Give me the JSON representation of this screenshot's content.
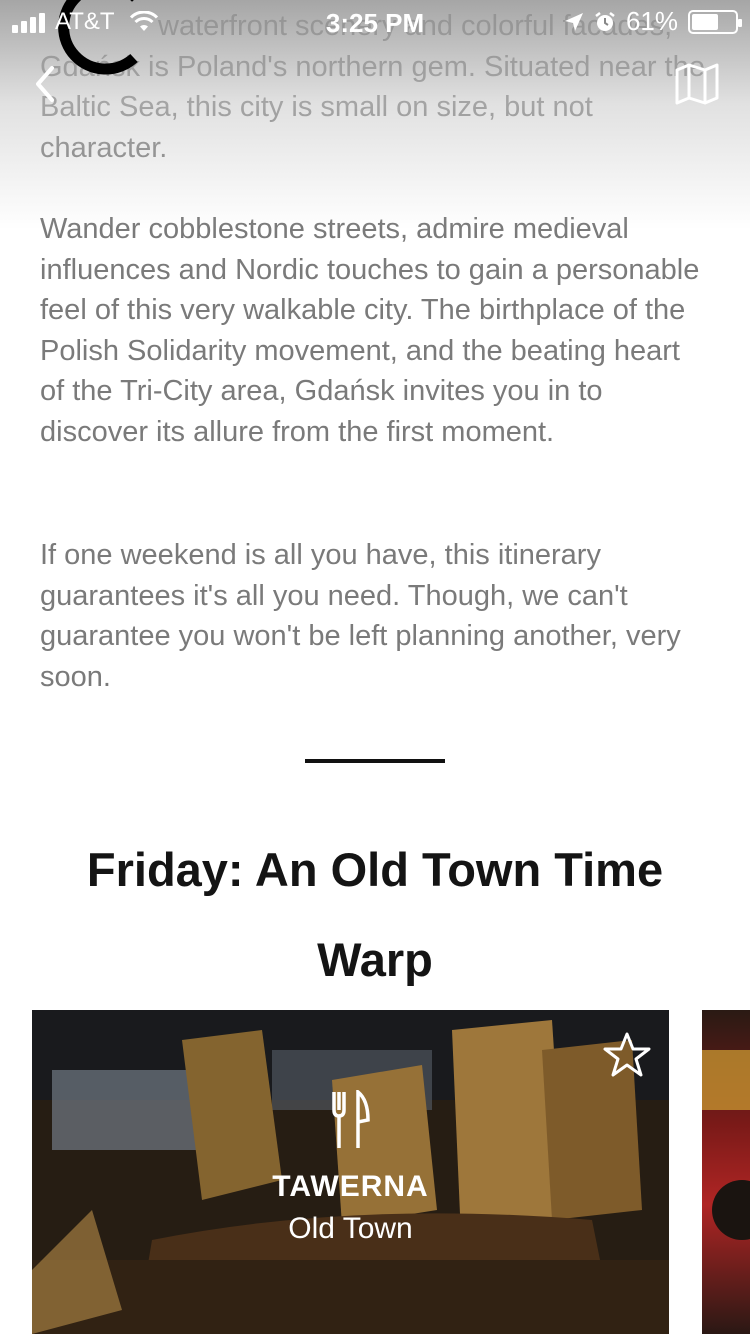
{
  "status_bar": {
    "carrier": "AT&T",
    "time": "3:25 PM",
    "battery_percent": "61%",
    "battery_level": 0.61
  },
  "intro": {
    "paragraph_1": "waterfront scenery and colorful facades, Gdańsk is Poland's northern gem. Situated near the Baltic Sea, this city is small on size, but not character.",
    "paragraph_2": "Wander cobblestone streets, admire medieval influences and Nordic touches to gain a personable feel of this very walkable city. The birthplace of the Polish Solidarity movement, and the beating heart of the Tri-City area, Gdańsk invites you in to discover its allure from the first moment.",
    "paragraph_3": "If one weekend is all you have, this itinerary guarantees it's all you need. Though, we can't guarantee you won't be left planning another, very soon."
  },
  "section": {
    "title": "Friday: An Old Town Time Warp"
  },
  "cards": [
    {
      "name": "TAWERNA",
      "area": "Old Town",
      "category_icon": "fork-knife-icon",
      "favorite_icon": "star-outline-icon"
    }
  ],
  "icons": {
    "back": "chevron-left-icon",
    "map": "map-icon"
  },
  "colors": {
    "body_text": "#7a7a7a",
    "title_text": "#141414",
    "divider": "#111111",
    "card_text": "#ffffff"
  }
}
